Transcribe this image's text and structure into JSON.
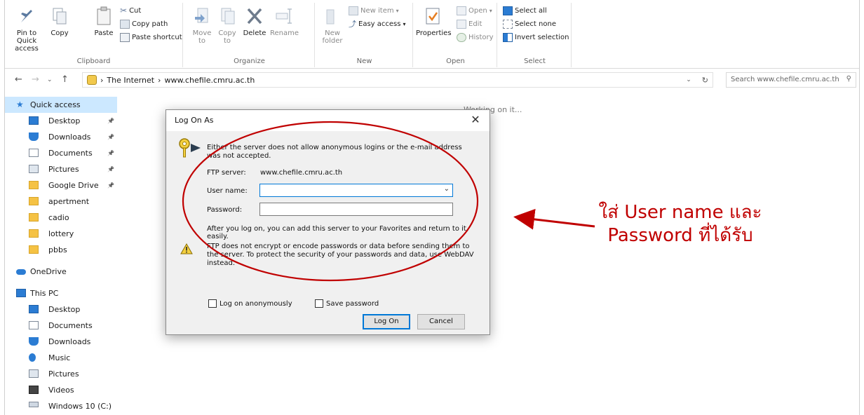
{
  "ribbon": {
    "clipboard": {
      "label": "Clipboard",
      "pin": "Pin to Quick access",
      "copy": "Copy",
      "paste": "Paste",
      "cut": "Cut",
      "copy_path": "Copy path",
      "paste_shortcut": "Paste shortcut"
    },
    "organize": {
      "label": "Organize",
      "move_to": "Move to",
      "copy_to": "Copy to",
      "delete": "Delete",
      "rename": "Rename"
    },
    "new": {
      "label": "New",
      "new_folder": "New folder",
      "new_item": "New item",
      "easy_access": "Easy access"
    },
    "open": {
      "label": "Open",
      "properties": "Properties",
      "open": "Open",
      "edit": "Edit",
      "history": "History"
    },
    "select": {
      "label": "Select",
      "select_all": "Select all",
      "select_none": "Select none",
      "invert_selection": "Invert selection"
    }
  },
  "address": {
    "crumb1": "The Internet",
    "crumb2": "www.chefile.cmru.ac.th",
    "search_placeholder": "Search www.chefile.cmru.ac.th"
  },
  "sidebar": {
    "quick_access": "Quick access",
    "quick_items": [
      "Desktop",
      "Downloads",
      "Documents",
      "Pictures",
      "Google Drive",
      "apertment",
      "cadio",
      "lottery",
      "pbbs"
    ],
    "onedrive": "OneDrive",
    "this_pc": "This PC",
    "pc_items": [
      "Desktop",
      "Documents",
      "Downloads",
      "Music",
      "Pictures",
      "Videos",
      "Windows 10 (C:)"
    ]
  },
  "content": {
    "status": "Working on it..."
  },
  "dialog": {
    "title": "Log On As",
    "message": "Either the server does not allow anonymous logins or the e-mail address was not accepted.",
    "ftp_server_label": "FTP server:",
    "ftp_server_value": "www.chefile.cmru.ac.th",
    "username_label": "User name:",
    "username_value": "",
    "password_label": "Password:",
    "password_value": "",
    "after_logon": "After you log on, you can add this server to your Favorites and return to it easily.",
    "warning": "FTP does not encrypt or encode passwords or data before sending them to the server.  To protect the security of your passwords and data, use WebDAV instead.",
    "anonymous_label": "Log on anonymously",
    "save_password_label": "Save password",
    "logon_button": "Log On",
    "cancel_button": "Cancel"
  },
  "annotation": {
    "line1": "ใส่ User name และ",
    "line2": "Password ที่ได้รับ",
    "color": "#c00000"
  }
}
